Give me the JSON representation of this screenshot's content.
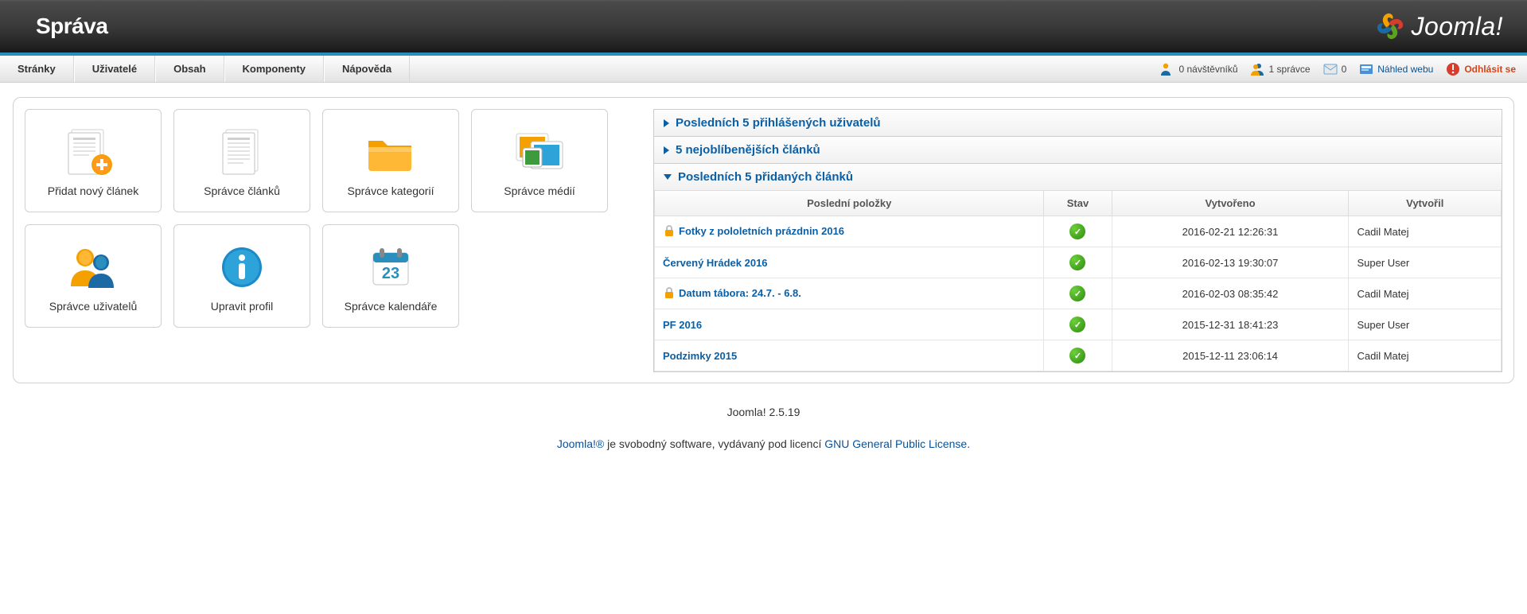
{
  "header": {
    "title": "Správa",
    "brand": "Joomla!"
  },
  "menu": {
    "items": [
      "Stránky",
      "Uživatelé",
      "Obsah",
      "Komponenty",
      "Nápověda"
    ]
  },
  "status": {
    "visitors": "0 návštěvníků",
    "admins": "1 správce",
    "messages": "0",
    "preview": "Náhled webu",
    "logout": "Odhlásit se"
  },
  "quickicons": [
    {
      "key": "add-article",
      "label": "Přidat nový článek"
    },
    {
      "key": "article-manager",
      "label": "Správce článků"
    },
    {
      "key": "category-manager",
      "label": "Správce kategorií"
    },
    {
      "key": "media-manager",
      "label": "Správce médií"
    },
    {
      "key": "user-manager",
      "label": "Správce uživatelů"
    },
    {
      "key": "profile",
      "label": "Upravit profil"
    },
    {
      "key": "calendar-manager",
      "label": "Správce kalendáře"
    }
  ],
  "panels": {
    "logged": "Posledních 5 přihlášených uživatelů",
    "popular": "5 nejoblíbenějších článků",
    "recent": "Posledních 5 přidaných článků"
  },
  "recent_table": {
    "headers": {
      "item": "Poslední položky",
      "state": "Stav",
      "created": "Vytvořeno",
      "author": "Vytvořil"
    },
    "rows": [
      {
        "locked": true,
        "title": "Fotky z pololetních prázdnin 2016",
        "created": "2016-02-21 12:26:31",
        "author": "Cadil Matej"
      },
      {
        "locked": false,
        "title": "Červený Hrádek 2016",
        "created": "2016-02-13 19:30:07",
        "author": "Super User"
      },
      {
        "locked": true,
        "title": "Datum tábora: 24.7. - 6.8.",
        "created": "2016-02-03 08:35:42",
        "author": "Cadil Matej"
      },
      {
        "locked": false,
        "title": "PF 2016",
        "created": "2015-12-31 18:41:23",
        "author": "Super User"
      },
      {
        "locked": false,
        "title": "Podzimky 2015",
        "created": "2015-12-11 23:06:14",
        "author": "Cadil Matej"
      }
    ]
  },
  "footer": {
    "version": "Joomla! 2.5.19",
    "link1": "Joomla!®",
    "text": " je svobodný software, vydávaný pod licencí ",
    "link2": "GNU General Public License."
  }
}
